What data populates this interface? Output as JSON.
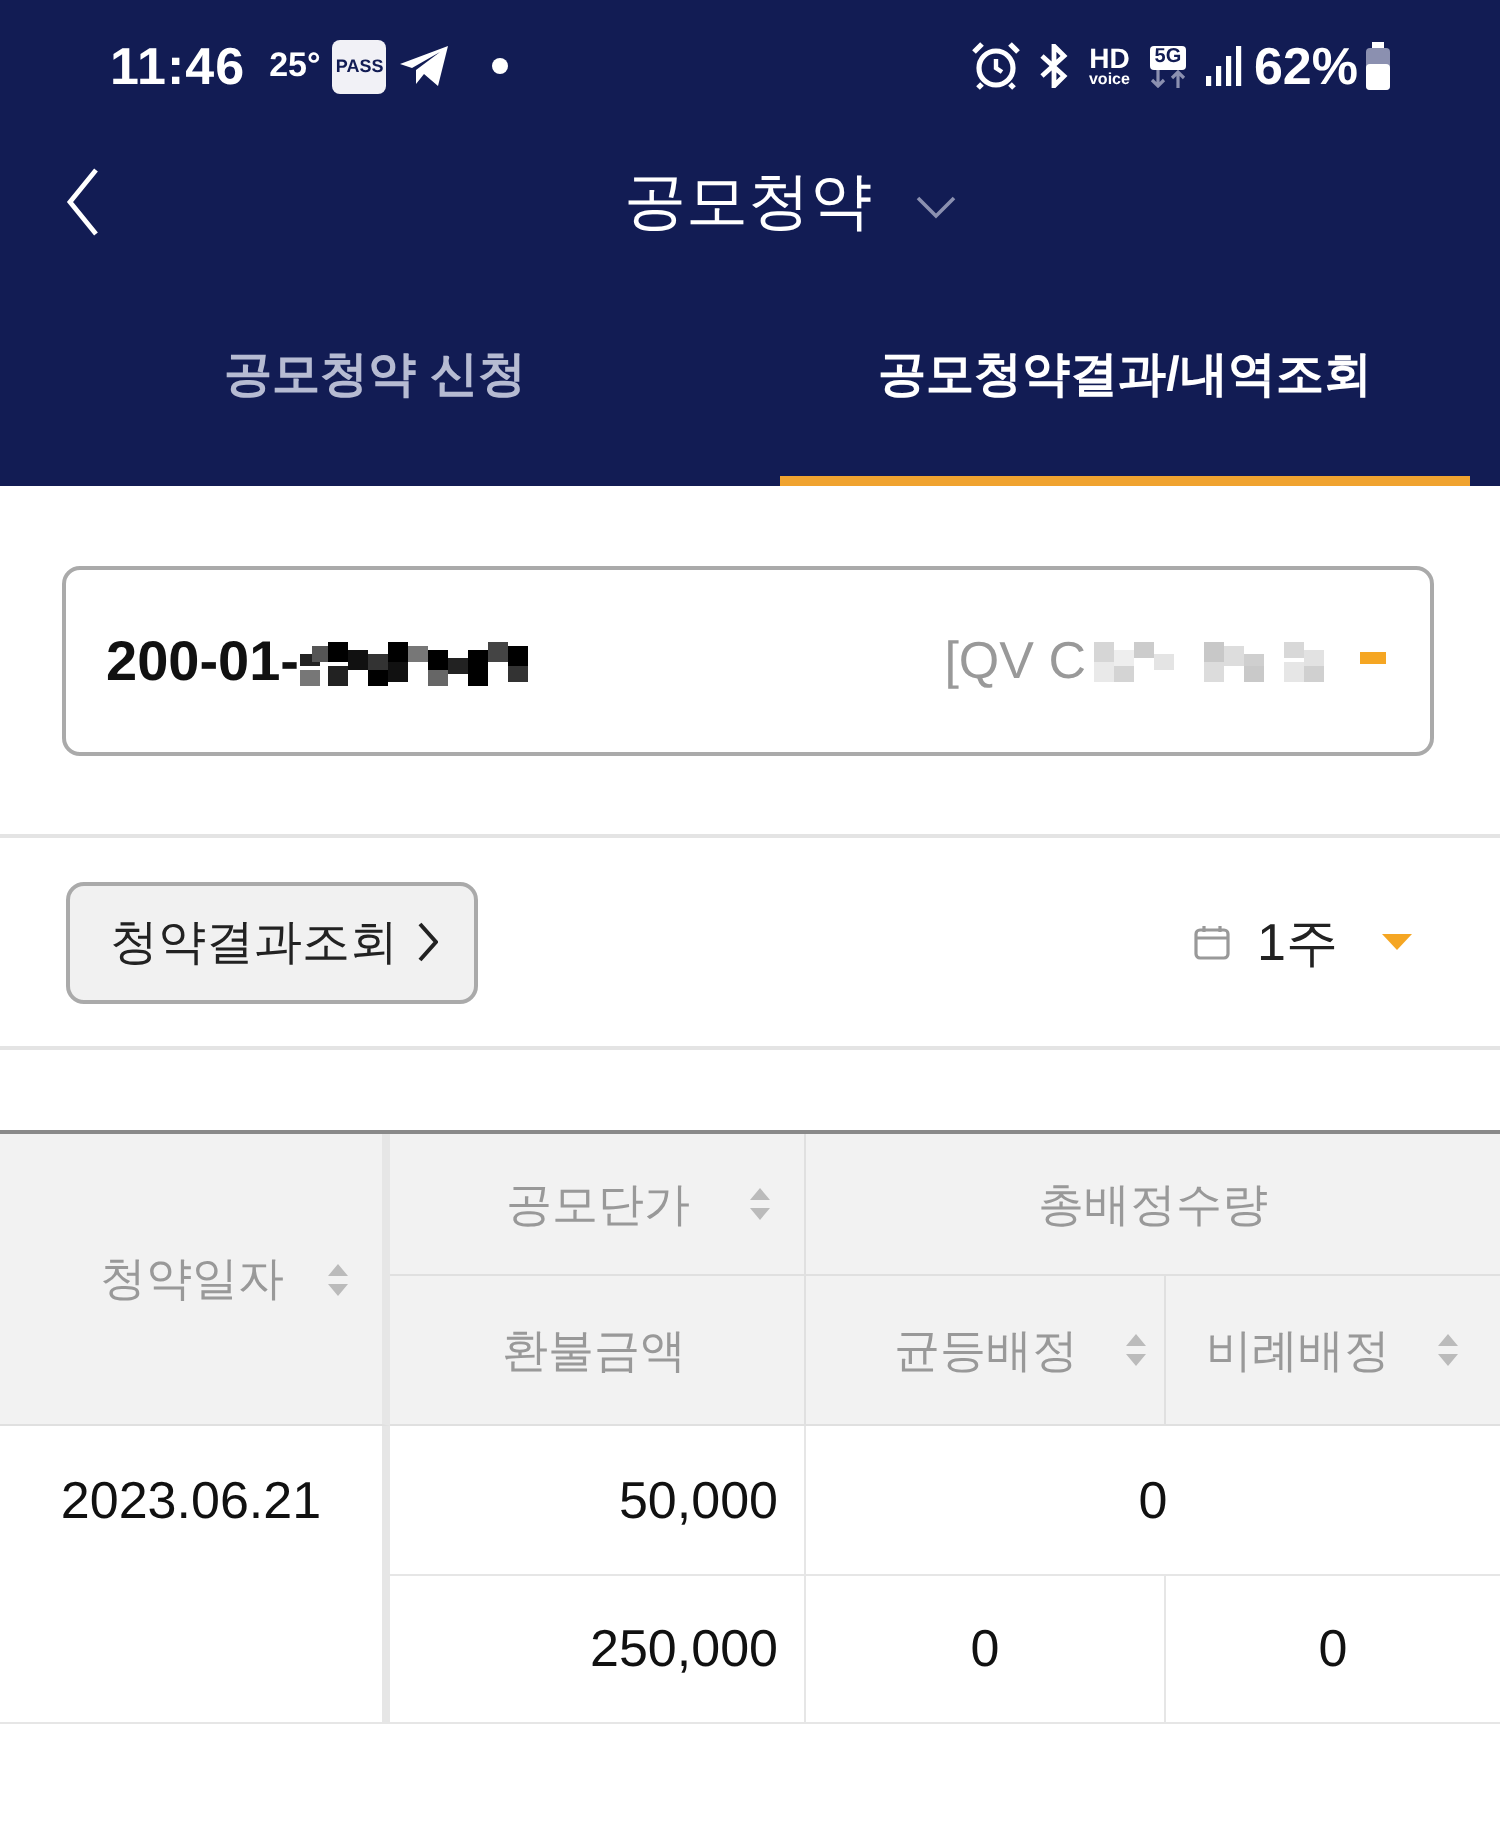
{
  "status_bar": {
    "time": "11:46",
    "temperature": "25°",
    "badge": "PASS",
    "hd": "HD",
    "voice": "voice",
    "network": "5G",
    "battery": "62%"
  },
  "header": {
    "title": "공모청약"
  },
  "tabs": [
    {
      "label": "공모청약 신청",
      "selected": false
    },
    {
      "label": "공모청약결과/내역조회",
      "selected": true
    }
  ],
  "account_select": {
    "account_number": "200-01-",
    "account_name": "[QV C"
  },
  "filter": {
    "button": "청약결과조회",
    "period": "1주"
  },
  "table": {
    "date_column": {
      "label": "청약일자",
      "sortable": true
    },
    "price_column": {
      "label": "공모단가",
      "sortable": true
    },
    "refund_column": {
      "label": "환불금액",
      "sortable": false
    },
    "allocation_group": {
      "label": "총배정수량"
    },
    "allocation_columns": [
      {
        "label": "균등배정",
        "sortable": true
      },
      {
        "label": "비례배정",
        "sortable": true
      }
    ],
    "rows": [
      {
        "date": "2023.06.21",
        "price": "50,000",
        "total_allocation": "0",
        "refund": "250,000",
        "allocations": [
          "0",
          "0"
        ]
      }
    ]
  }
}
